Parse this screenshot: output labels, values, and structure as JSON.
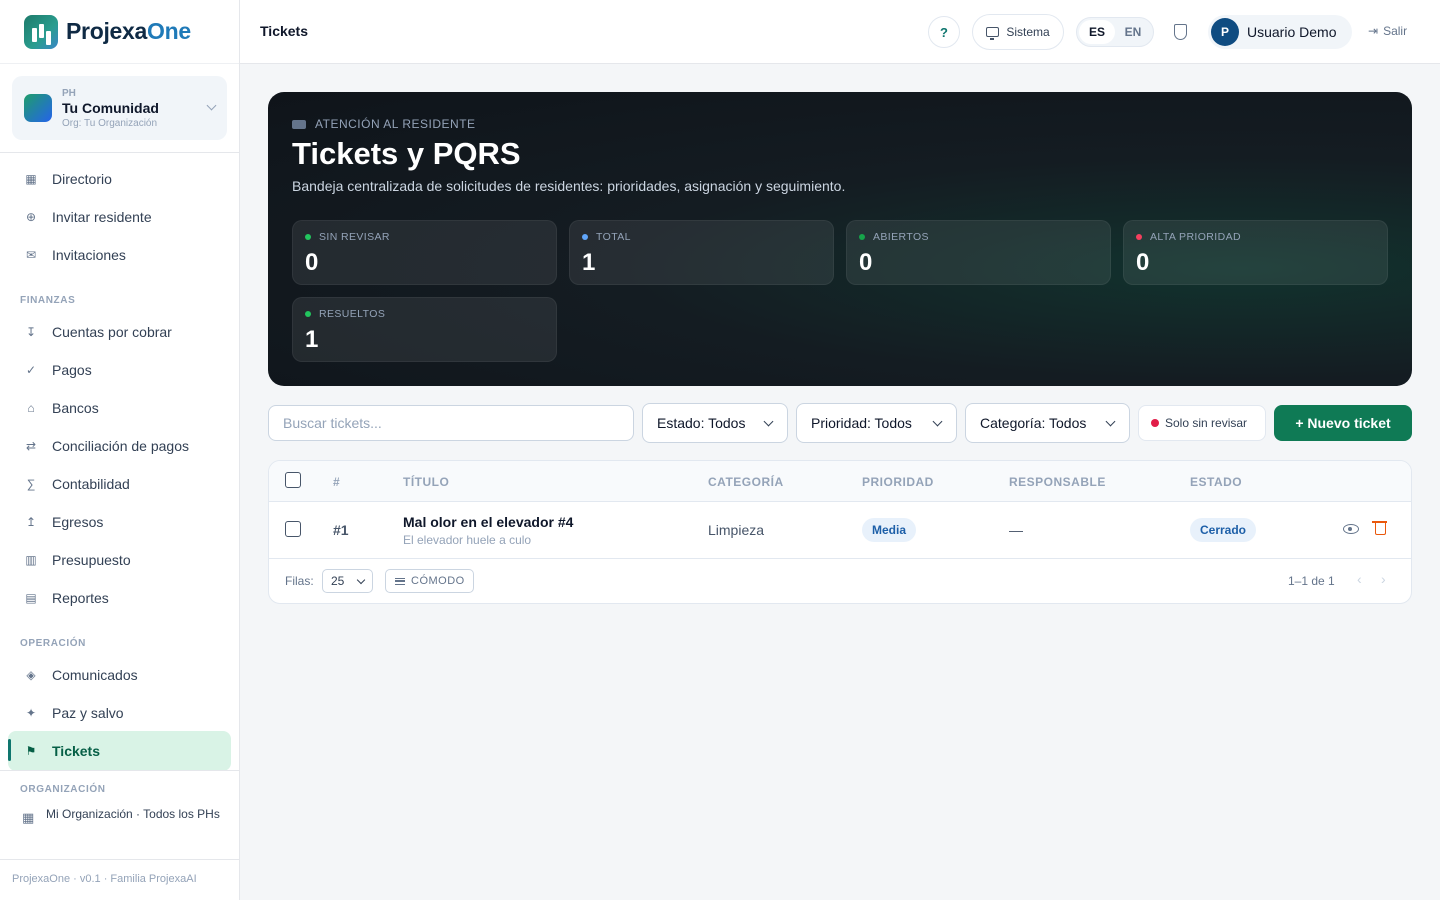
{
  "brand": {
    "name_part1": "Projexa",
    "name_part2": "One"
  },
  "ph": {
    "kind": "PH",
    "name": "Tu Comunidad",
    "org": "Org: Tu Organización"
  },
  "sidebar": {
    "top_items": [
      {
        "label": "Directorio",
        "icon": "grid-icon"
      },
      {
        "label": "Invitar residente",
        "icon": "plus-circle-icon"
      },
      {
        "label": "Invitaciones",
        "icon": "mail-icon"
      }
    ],
    "finanzas_label": "FINANZAS",
    "finanzas_items": [
      {
        "label": "Cuentas por cobrar",
        "icon": "receivable-icon"
      },
      {
        "label": "Pagos",
        "icon": "check-icon"
      },
      {
        "label": "Bancos",
        "icon": "bank-icon"
      },
      {
        "label": "Conciliación de pagos",
        "icon": "swap-icon"
      },
      {
        "label": "Contabilidad",
        "icon": "sigma-icon"
      },
      {
        "label": "Egresos",
        "icon": "expense-icon"
      },
      {
        "label": "Presupuesto",
        "icon": "budget-icon"
      },
      {
        "label": "Reportes",
        "icon": "report-icon"
      }
    ],
    "operacion_label": "OPERACIÓN",
    "operacion_items": [
      {
        "label": "Comunicados",
        "icon": "diamond-icon"
      },
      {
        "label": "Paz y salvo",
        "icon": "sparkle-icon"
      },
      {
        "label": "Tickets",
        "icon": "flag-icon",
        "active": true
      }
    ],
    "organizacion_label": "ORGANIZACIÓN",
    "org_item": "Mi Organización · Todos los PHs",
    "footer": "ProjexaOne · v0.1 · Familia ProjexaAI"
  },
  "header": {
    "title": "Tickets",
    "help": "?",
    "system": "Sistema",
    "lang_es": "ES",
    "lang_en": "EN",
    "user_initial": "P",
    "user_name": "Usuario Demo",
    "logout": "Salir"
  },
  "hero": {
    "eyebrow": "ATENCIÓN AL RESIDENTE",
    "title": "Tickets y PQRS",
    "subtitle": "Bandeja centralizada de solicitudes de residentes: prioridades, asignación y seguimiento.",
    "kpis": [
      {
        "label": "SIN REVISAR",
        "value": "0",
        "dot": "#22c55e"
      },
      {
        "label": "TOTAL",
        "value": "1",
        "dot": "#60a5fa"
      },
      {
        "label": "ABIERTOS",
        "value": "0",
        "dot": "#16a34a"
      },
      {
        "label": "ALTA PRIORIDAD",
        "value": "0",
        "dot": "#f43f5e"
      },
      {
        "label": "RESUELTOS",
        "value": "1",
        "dot": "#22c55e"
      }
    ]
  },
  "toolbar": {
    "search_placeholder": "Buscar tickets...",
    "estado": "Estado: Todos",
    "prioridad": "Prioridad: Todos",
    "categoria": "Categoría: Todos",
    "unread": "Solo sin revisar",
    "new_ticket": "+ Nuevo ticket"
  },
  "table": {
    "columns": {
      "num": "#",
      "titulo": "TÍTULO",
      "categoria": "CATEGORÍA",
      "prioridad": "PRIORIDAD",
      "responsable": "RESPONSABLE",
      "estado": "ESTADO"
    },
    "rows": [
      {
        "num": "#1",
        "title": "Mal olor en el elevador #4",
        "desc": "El elevador huele a culo",
        "categoria": "Limpieza",
        "prioridad": "Media",
        "responsable": "—",
        "estado": "Cerrado"
      }
    ],
    "footer": {
      "rows_label": "Filas:",
      "rows_value": "25",
      "density": "CÓMODO",
      "range": "1–1 de 1",
      "prev": "‹",
      "next": "›"
    }
  },
  "colors": {
    "accent": "#0f7a55",
    "active_bg": "#d9f3e6",
    "badge_bg": "#e8f1fb",
    "badge_text": "#1d5fa8",
    "trash": "#ea580c"
  }
}
